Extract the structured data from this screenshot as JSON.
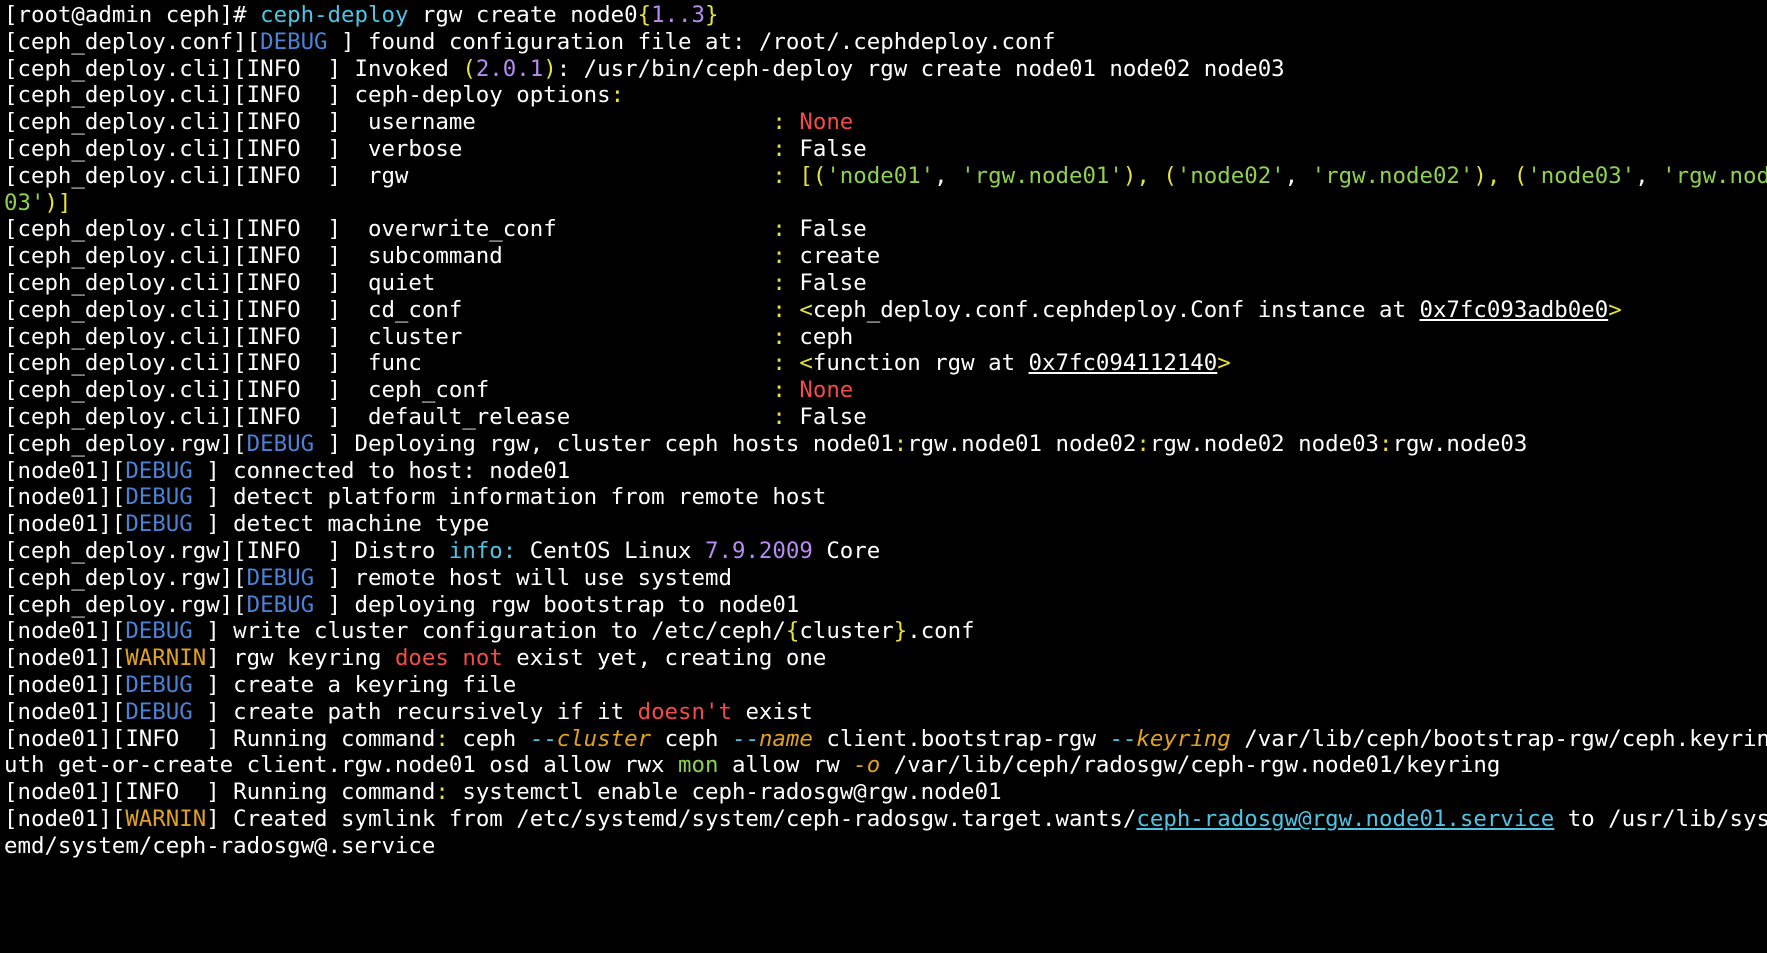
{
  "terminal": {
    "colors": {
      "background": "#000000",
      "default": "#ffffff",
      "cyan": "#4fc3e3",
      "blue_debug": "#4c82d6",
      "yellow": "#e8e23a",
      "green": "#8fd14f",
      "red": "#f24b4b",
      "purple": "#b58cf0",
      "orange": "#e0a020",
      "wrap_marker": "#4fc3e3"
    },
    "lines": [
      [
        {
          "t": "[root@admin ceph]# ",
          "c": "default"
        },
        {
          "t": "ceph-deploy",
          "c": "cyan"
        },
        {
          "t": " rgw create node0",
          "c": "default"
        },
        {
          "t": "{",
          "c": "yellow"
        },
        {
          "t": "1..3",
          "c": "purple"
        },
        {
          "t": "}",
          "c": "yellow"
        }
      ],
      [
        {
          "t": "[ceph_deploy.conf][",
          "c": "default"
        },
        {
          "t": "DEBUG",
          "c": "blue_debug"
        },
        {
          "t": " ] found configuration file at: /root/.cephdeploy.conf",
          "c": "default"
        }
      ],
      [
        {
          "t": "[ceph_deploy.cli][INFO  ] Invoked ",
          "c": "default"
        },
        {
          "t": "(",
          "c": "yellow"
        },
        {
          "t": "2.0.1",
          "c": "purple"
        },
        {
          "t": ")",
          "c": "yellow"
        },
        {
          "t": ": /usr/bin/ceph-deploy rgw create node01 node02 node03",
          "c": "default"
        }
      ],
      [
        {
          "t": "[ceph_deploy.cli][INFO  ] ceph-deploy options",
          "c": "default"
        },
        {
          "t": ":",
          "c": "yellow"
        }
      ],
      [
        {
          "t": "[ceph_deploy.cli][INFO  ]  username                      ",
          "c": "default"
        },
        {
          "t": ": ",
          "c": "yellow"
        },
        {
          "t": "None",
          "c": "red"
        }
      ],
      [
        {
          "t": "[ceph_deploy.cli][INFO  ]  verbose                       ",
          "c": "default"
        },
        {
          "t": ": ",
          "c": "yellow"
        },
        {
          "t": "False",
          "c": "default"
        }
      ],
      [
        {
          "t": "[ceph_deploy.cli][INFO  ]  rgw                           ",
          "c": "default"
        },
        {
          "t": ": [(",
          "c": "yellow"
        },
        {
          "t": "'node01'",
          "c": "green"
        },
        {
          "t": ", ",
          "c": "default"
        },
        {
          "t": "'rgw.node01'",
          "c": "green"
        },
        {
          "t": "), (",
          "c": "yellow"
        },
        {
          "t": "'node02'",
          "c": "green"
        },
        {
          "t": ", ",
          "c": "default"
        },
        {
          "t": "'rgw.node02'",
          "c": "green"
        },
        {
          "t": "), (",
          "c": "yellow"
        },
        {
          "t": "'node03'",
          "c": "green"
        },
        {
          "t": ", ",
          "c": "default"
        },
        {
          "t": "'rgw.node",
          "c": "green"
        },
        {
          "t": " ↵",
          "c": "wrap_marker"
        }
      ],
      [
        {
          "t": "03'",
          "c": "green"
        },
        {
          "t": ")]",
          "c": "yellow"
        }
      ],
      [
        {
          "t": "[ceph_deploy.cli][INFO  ]  overwrite_conf                ",
          "c": "default"
        },
        {
          "t": ": ",
          "c": "yellow"
        },
        {
          "t": "False",
          "c": "default"
        }
      ],
      [
        {
          "t": "[ceph_deploy.cli][INFO  ]  subcommand                    ",
          "c": "default"
        },
        {
          "t": ": ",
          "c": "yellow"
        },
        {
          "t": "create",
          "c": "default"
        }
      ],
      [
        {
          "t": "[ceph_deploy.cli][INFO  ]  quiet                         ",
          "c": "default"
        },
        {
          "t": ": ",
          "c": "yellow"
        },
        {
          "t": "False",
          "c": "default"
        }
      ],
      [
        {
          "t": "[ceph_deploy.cli][INFO  ]  cd_conf                       ",
          "c": "default"
        },
        {
          "t": ": ",
          "c": "yellow"
        },
        {
          "t": "<",
          "c": "yellow"
        },
        {
          "t": "ceph_deploy.conf.cephdeploy.Conf instance at ",
          "c": "default"
        },
        {
          "t": "0x7fc093adb0e0",
          "c": "default",
          "u": true
        },
        {
          "t": ">",
          "c": "yellow"
        }
      ],
      [
        {
          "t": "[ceph_deploy.cli][INFO  ]  cluster                       ",
          "c": "default"
        },
        {
          "t": ": ",
          "c": "yellow"
        },
        {
          "t": "ceph",
          "c": "default"
        }
      ],
      [
        {
          "t": "[ceph_deploy.cli][INFO  ]  func                          ",
          "c": "default"
        },
        {
          "t": ": ",
          "c": "yellow"
        },
        {
          "t": "<",
          "c": "yellow"
        },
        {
          "t": "function rgw at ",
          "c": "default"
        },
        {
          "t": "0x7fc094112140",
          "c": "default",
          "u": true
        },
        {
          "t": ">",
          "c": "yellow"
        }
      ],
      [
        {
          "t": "[ceph_deploy.cli][INFO  ]  ceph_conf                     ",
          "c": "default"
        },
        {
          "t": ": ",
          "c": "yellow"
        },
        {
          "t": "None",
          "c": "red"
        }
      ],
      [
        {
          "t": "[ceph_deploy.cli][INFO  ]  default_release               ",
          "c": "default"
        },
        {
          "t": ": ",
          "c": "yellow"
        },
        {
          "t": "False",
          "c": "default"
        }
      ],
      [
        {
          "t": "[ceph_deploy.rgw][",
          "c": "default"
        },
        {
          "t": "DEBUG",
          "c": "blue_debug"
        },
        {
          "t": " ] Deploying rgw, cluster ceph hosts node01",
          "c": "default"
        },
        {
          "t": ":",
          "c": "yellow"
        },
        {
          "t": "rgw.node01 node02",
          "c": "default"
        },
        {
          "t": ":",
          "c": "yellow"
        },
        {
          "t": "rgw.node02 node03",
          "c": "default"
        },
        {
          "t": ":",
          "c": "yellow"
        },
        {
          "t": "rgw.node03",
          "c": "default"
        }
      ],
      [
        {
          "t": "[node01][",
          "c": "default"
        },
        {
          "t": "DEBUG",
          "c": "blue_debug"
        },
        {
          "t": " ] connected to host: node01",
          "c": "default"
        }
      ],
      [
        {
          "t": "[node01][",
          "c": "default"
        },
        {
          "t": "DEBUG",
          "c": "blue_debug"
        },
        {
          "t": " ] detect platform information from remote host",
          "c": "default"
        }
      ],
      [
        {
          "t": "[node01][",
          "c": "default"
        },
        {
          "t": "DEBUG",
          "c": "blue_debug"
        },
        {
          "t": " ] detect machine type",
          "c": "default"
        }
      ],
      [
        {
          "t": "[ceph_deploy.rgw][INFO  ] Distro ",
          "c": "default"
        },
        {
          "t": "info:",
          "c": "cyan"
        },
        {
          "t": " CentOS Linux ",
          "c": "default"
        },
        {
          "t": "7.9.2009",
          "c": "purple"
        },
        {
          "t": " Core",
          "c": "default"
        }
      ],
      [
        {
          "t": "[ceph_deploy.rgw][",
          "c": "default"
        },
        {
          "t": "DEBUG",
          "c": "blue_debug"
        },
        {
          "t": " ] remote host will use systemd",
          "c": "default"
        }
      ],
      [
        {
          "t": "[ceph_deploy.rgw][",
          "c": "default"
        },
        {
          "t": "DEBUG",
          "c": "blue_debug"
        },
        {
          "t": " ] deploying rgw bootstrap to node01",
          "c": "default"
        }
      ],
      [
        {
          "t": "[node01][",
          "c": "default"
        },
        {
          "t": "DEBUG",
          "c": "blue_debug"
        },
        {
          "t": " ] write cluster configuration to /etc/ceph/",
          "c": "default"
        },
        {
          "t": "{",
          "c": "yellow"
        },
        {
          "t": "cluster",
          "c": "default"
        },
        {
          "t": "}",
          "c": "yellow"
        },
        {
          "t": ".conf",
          "c": "default"
        }
      ],
      [
        {
          "t": "[node01][",
          "c": "default"
        },
        {
          "t": "WARNIN",
          "c": "orange"
        },
        {
          "t": "] rgw keyring ",
          "c": "default"
        },
        {
          "t": "does not",
          "c": "red"
        },
        {
          "t": " exist yet, creating one",
          "c": "default"
        }
      ],
      [
        {
          "t": "[node01][",
          "c": "default"
        },
        {
          "t": "DEBUG",
          "c": "blue_debug"
        },
        {
          "t": " ] create a keyring file",
          "c": "default"
        }
      ],
      [
        {
          "t": "[node01][",
          "c": "default"
        },
        {
          "t": "DEBUG",
          "c": "blue_debug"
        },
        {
          "t": " ] create path recursively if it ",
          "c": "default"
        },
        {
          "t": "doesn't",
          "c": "red"
        },
        {
          "t": " exist",
          "c": "default"
        }
      ],
      [
        {
          "t": "[node01][INFO  ] Running command",
          "c": "default"
        },
        {
          "t": ":",
          "c": "yellow"
        },
        {
          "t": " ceph ",
          "c": "default"
        },
        {
          "t": "--",
          "c": "cyan"
        },
        {
          "t": "cluster",
          "c": "orange",
          "i": true
        },
        {
          "t": " ceph ",
          "c": "default"
        },
        {
          "t": "--",
          "c": "cyan"
        },
        {
          "t": "name",
          "c": "orange",
          "i": true
        },
        {
          "t": " client.bootstrap-rgw ",
          "c": "default"
        },
        {
          "t": "--",
          "c": "cyan"
        },
        {
          "t": "keyring",
          "c": "orange",
          "i": true
        },
        {
          "t": " /var/lib/ceph/bootstrap-rgw/ceph.keyring a",
          "c": "default"
        },
        {
          "t": " ↵",
          "c": "wrap_marker"
        }
      ],
      [
        {
          "t": "uth get-or-create client.rgw.node01 osd allow rwx ",
          "c": "default"
        },
        {
          "t": "mon",
          "c": "green"
        },
        {
          "t": " allow rw ",
          "c": "default"
        },
        {
          "t": "-o",
          "c": "orange",
          "i": true
        },
        {
          "t": " /var/lib/ceph/radosgw/ceph-rgw.node01/keyring",
          "c": "default"
        }
      ],
      [
        {
          "t": "[node01][INFO  ] Running command",
          "c": "default"
        },
        {
          "t": ":",
          "c": "yellow"
        },
        {
          "t": " systemctl enable ceph-radosgw@rgw.node01",
          "c": "default"
        }
      ],
      [
        {
          "t": "[node01][",
          "c": "default"
        },
        {
          "t": "WARNIN",
          "c": "orange"
        },
        {
          "t": "] Created symlink from /etc/systemd/system/ceph-radosgw.target.wants/",
          "c": "default"
        },
        {
          "t": "ceph-radosgw@rgw.node01.service",
          "c": "cyan",
          "u": true
        },
        {
          "t": " to /usr/lib/syst",
          "c": "default"
        },
        {
          "t": " ↵",
          "c": "wrap_marker"
        }
      ],
      [
        {
          "t": "emd/system/ceph-radosgw@.service",
          "c": "default"
        }
      ]
    ]
  }
}
